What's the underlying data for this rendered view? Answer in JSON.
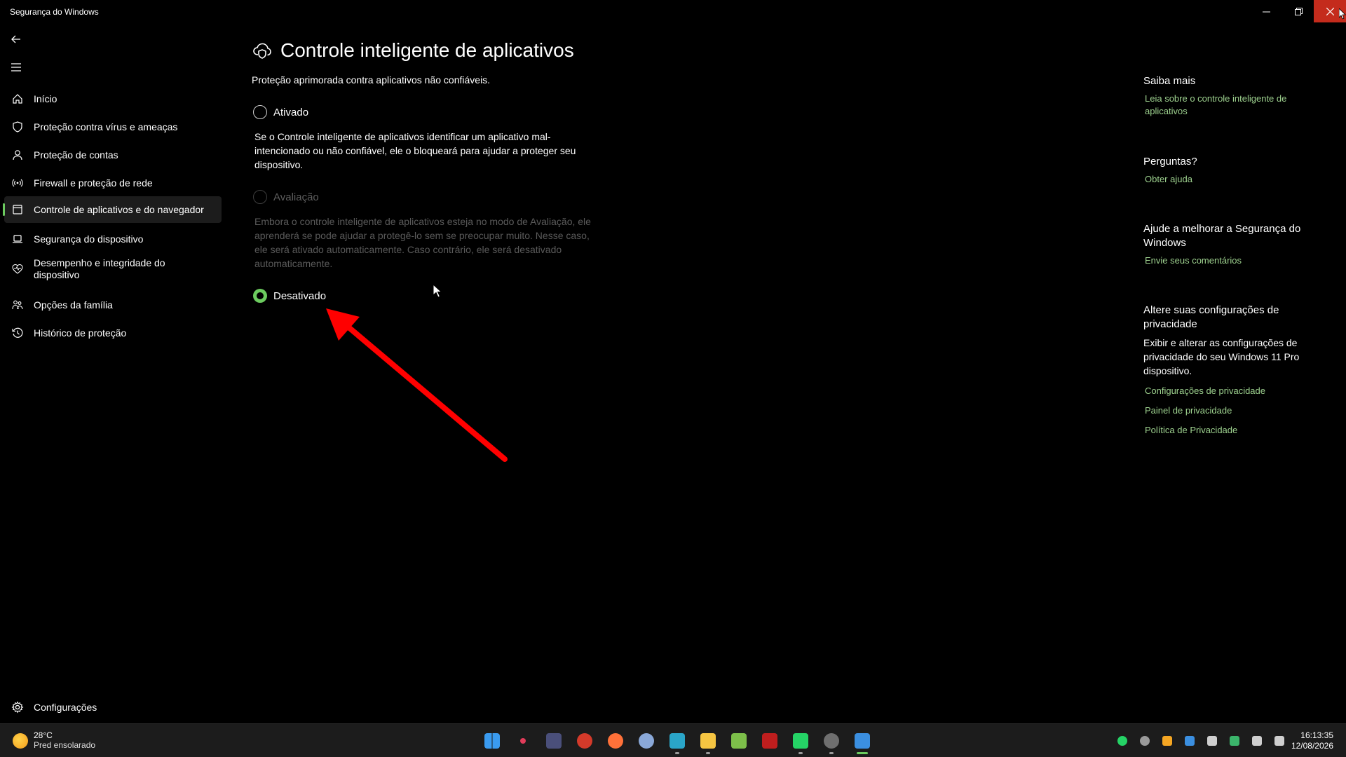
{
  "window": {
    "title": "Segurança do Windows",
    "minimize_icon": "minimize-icon",
    "maximize_icon": "restore-icon",
    "close_icon": "close-icon",
    "close_color": "#c42b1c"
  },
  "sidebar": {
    "back_icon": "back-arrow-icon",
    "menu_icon": "hamburger-menu-icon",
    "items": [
      {
        "label": "Início",
        "icon": "home-icon"
      },
      {
        "label": "Proteção contra vírus e ameaças",
        "icon": "shield-icon"
      },
      {
        "label": "Proteção de contas",
        "icon": "person-icon"
      },
      {
        "label": "Firewall e proteção de rede",
        "icon": "wireless-icon"
      },
      {
        "label": "Controle de aplicativos e do navegador",
        "icon": "app-browser-icon",
        "active": true
      },
      {
        "label": "Segurança do dispositivo",
        "icon": "laptop-icon"
      },
      {
        "label": "Desempenho e integridade do dispositivo",
        "icon": "heart-pulse-icon"
      },
      {
        "label": "Opções da família",
        "icon": "family-icon"
      },
      {
        "label": "Histórico de proteção",
        "icon": "history-icon"
      }
    ],
    "settings": {
      "label": "Configurações",
      "icon": "gear-icon"
    }
  },
  "main": {
    "title": "Controle inteligente de aplicativos",
    "title_icon": "smart-app-control-icon",
    "subtitle": "Proteção aprimorada contra aplicativos não confiáveis.",
    "options": [
      {
        "label": "Ativado",
        "selected": false,
        "disabled": false,
        "description": "Se o Controle inteligente de aplicativos identificar um aplicativo mal-intencionado ou não confiável, ele o bloqueará para ajudar a proteger seu dispositivo."
      },
      {
        "label": "Avaliação",
        "selected": false,
        "disabled": true,
        "description": "Embora o controle inteligente de aplicativos esteja no modo de Avaliação, ele aprenderá se pode ajudar a protegê-lo sem se preocupar muito. Nesse caso, ele será ativado automaticamente. Caso contrário, ele será desativado automaticamente."
      },
      {
        "label": "Desativado",
        "selected": true,
        "disabled": false
      }
    ]
  },
  "right": {
    "learn_more": {
      "heading": "Saiba mais",
      "link": "Leia sobre o controle inteligente de aplicativos"
    },
    "questions": {
      "heading": "Perguntas?",
      "link": "Obter ajuda"
    },
    "improve": {
      "heading": "Ajude a melhorar a Segurança do Windows",
      "link": "Envie seus comentários"
    },
    "privacy": {
      "heading": "Altere suas configurações de privacidade",
      "text": "Exibir e alterar as configurações de privacidade do seu Windows 11 Pro dispositivo.",
      "links": [
        "Configurações de privacidade",
        "Painel de privacidade",
        "Política de Privacidade"
      ]
    }
  },
  "annotation": {
    "arrow_color": "#ff0000"
  },
  "taskbar": {
    "weather": {
      "temp": "28°C",
      "desc": "Pred ensolarado",
      "icon": "sun-icon"
    },
    "apps": [
      {
        "icon": "windows-start-icon",
        "color": "#3a9bf0"
      },
      {
        "icon": "media-app-icon",
        "color": "#2a2a2a"
      },
      {
        "icon": "app-icon",
        "color": "#4a4f7a"
      },
      {
        "icon": "browser-app-icon",
        "color": "#d43a2a"
      },
      {
        "icon": "firefox-icon",
        "color": "#ff7139"
      },
      {
        "icon": "settings-icon",
        "color": "#8aa8d8"
      },
      {
        "icon": "mail-app-icon",
        "color": "#2aa5c8"
      },
      {
        "icon": "file-explorer-icon",
        "color": "#f5c542"
      },
      {
        "icon": "notepad-icon",
        "color": "#7dbf4a"
      },
      {
        "icon": "filezilla-icon",
        "color": "#bf1e1e"
      },
      {
        "icon": "whatsapp-icon",
        "color": "#25d366"
      },
      {
        "icon": "chrome-like-icon",
        "color": "#6f6f6f"
      },
      {
        "icon": "windows-security-icon",
        "color": "#3b8fe0"
      }
    ],
    "tray_icons": [
      "whatsapp-tray-icon",
      "app-tray-icon",
      "cloud-tray-icon",
      "app2-tray-icon",
      "usb-tray-icon",
      "security-tray-icon",
      "network-icon",
      "volume-icon"
    ],
    "time": "16:13:35",
    "date": "12/08/2026"
  }
}
